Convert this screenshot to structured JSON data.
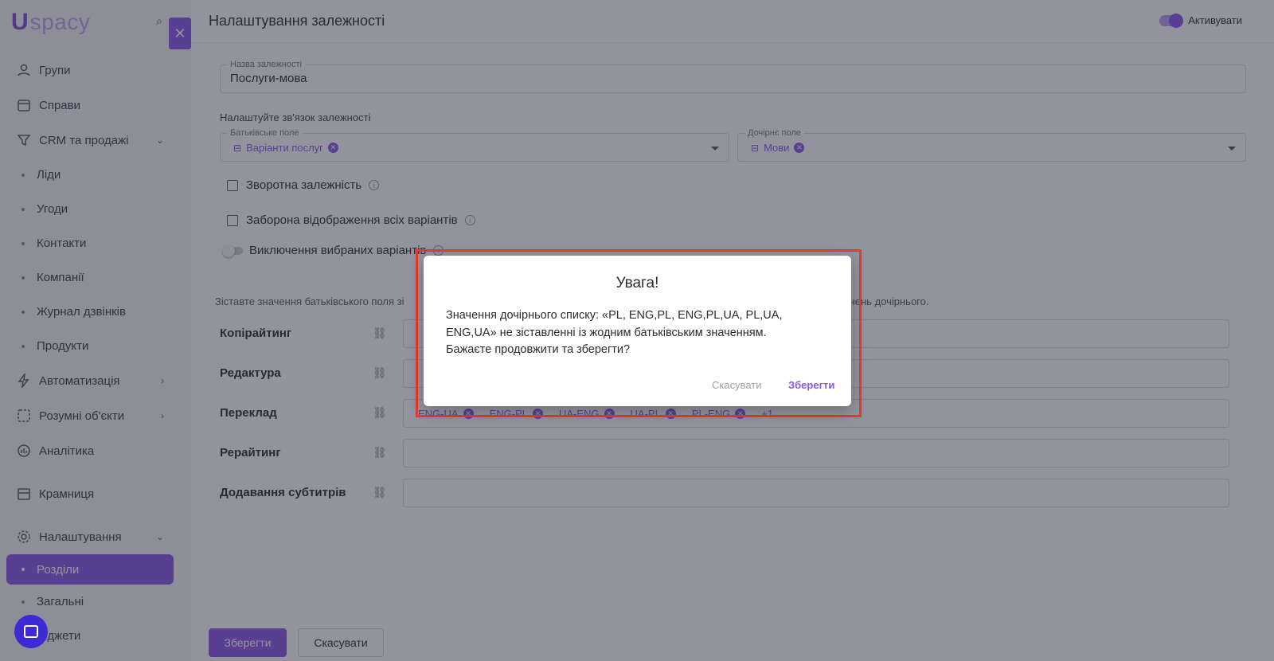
{
  "brand": {
    "mark": "U",
    "name": "spacy",
    "accent": "#8a56e6"
  },
  "sidebar": {
    "items": [
      {
        "label": "Групи",
        "icon": "users-icon"
      },
      {
        "label": "Справи",
        "icon": "calendar-icon"
      },
      {
        "label": "CRM та продажі",
        "icon": "funnel-icon",
        "expanded": true
      },
      {
        "label": "Ліди",
        "sub": true
      },
      {
        "label": "Угоди",
        "sub": true
      },
      {
        "label": "Контакти",
        "sub": true
      },
      {
        "label": "Компанії",
        "sub": true
      },
      {
        "label": "Журнал дзвінків",
        "sub": true
      },
      {
        "label": "Продукти",
        "sub": true
      },
      {
        "label": "Автоматизація",
        "icon": "lightning-icon"
      },
      {
        "label": "Розумні об'єкти",
        "icon": "smart-objects-icon"
      },
      {
        "label": "Аналітика",
        "icon": "chart-icon"
      },
      {
        "label": "Крамниця",
        "icon": "store-icon"
      },
      {
        "label": "Налаштування",
        "icon": "gear-icon",
        "expanded": true
      },
      {
        "label": "Розділи",
        "sub": true,
        "active": true
      },
      {
        "label": "Загальні",
        "sub": true
      },
      {
        "label": "Віджети",
        "sub": true
      }
    ]
  },
  "header": {
    "title": "Налаштування залежності",
    "activate_label": "Активувати"
  },
  "form": {
    "name_label": "Назва залежності",
    "name_value": "Послуги-мова",
    "config_label": "Налаштуйте зв'язок залежності",
    "parent_label": "Батьківське поле",
    "parent_value": "Варіанти послуг",
    "child_label": "Дочірнє поле",
    "child_value": "Мови",
    "reverse_label": "Зворотна залежність",
    "forbid_label": "Заборона відображення всіх варіантів",
    "exclude_label": "Виключення вибраних варіантів"
  },
  "mapping": {
    "hint_start": "Зіставте значення батьківського поля зі",
    "hint_end": "чень дочірнього.",
    "rows": [
      {
        "label": "Копірайтинг",
        "chips": []
      },
      {
        "label": "Редактура",
        "chips": []
      },
      {
        "label": "Переклад",
        "chips": [
          "ENG-UA",
          "ENG-PL",
          "UA-ENG",
          "UA-PL",
          "PL-ENG"
        ],
        "more": "+1"
      },
      {
        "label": "Рерайтинг",
        "chips": []
      },
      {
        "label": "Додавання субтитрів",
        "chips": []
      }
    ]
  },
  "footer": {
    "save_label": "Зберегти",
    "cancel_label": "Скасувати"
  },
  "dialog": {
    "title": "Увага!",
    "line1": "Значення дочірнього списку: «PL, ENG,PL, ENG,PL,UA, PL,UA,",
    "line2": "ENG,UA» не зіставленні із жодним батьківським значенням.",
    "line3": "Бажаєте продовжити та зберегти?",
    "cancel_label": "Скасувати",
    "save_label": "Зберегти"
  }
}
